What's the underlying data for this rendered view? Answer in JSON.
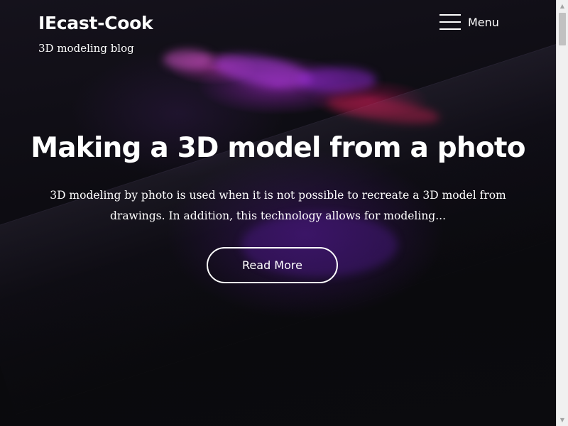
{
  "header": {
    "site_title": "IEcast-Cook",
    "tagline": "3D modeling blog",
    "menu": {
      "label": "Menu",
      "icon": "hamburger-menu-icon"
    }
  },
  "hero": {
    "post_title": "Making a 3D model from a photo",
    "excerpt": "3D modeling by photo is used when it is not possible to recreate a 3D model from drawings. In addition, this technology allows for modeling...",
    "read_more_label": "Read More"
  },
  "colors": {
    "text": "#ffffff",
    "background": "#0b0b0e",
    "accent_purple": "#7a2ad0",
    "accent_magenta": "#c8145a"
  }
}
